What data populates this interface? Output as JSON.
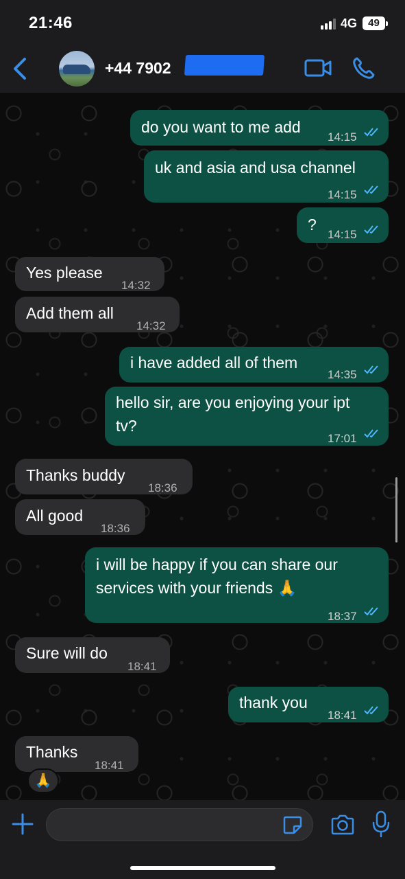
{
  "status": {
    "time": "21:46",
    "network": "4G",
    "battery": "49"
  },
  "header": {
    "contact": "+44 7902 ",
    "icons": [
      "back-chevron-icon",
      "video-call-icon",
      "phone-icon"
    ]
  },
  "colors": {
    "outgoing": "#0c5143",
    "incoming": "#2d2d2f",
    "accent": "#3a8ee6",
    "ticks": "#4fb6ff"
  },
  "messages": [
    {
      "dir": "out",
      "text": "do you want to me add",
      "time": "14:15"
    },
    {
      "dir": "out",
      "text": "uk and asia and usa channel",
      "time": "14:15"
    },
    {
      "dir": "out",
      "text": "?",
      "time": "14:15"
    },
    {
      "dir": "in",
      "text": "Yes please",
      "time": "14:32"
    },
    {
      "dir": "in",
      "text": "Add them all",
      "time": "14:32"
    },
    {
      "dir": "out",
      "text": "i have added all of them",
      "time": "14:35"
    },
    {
      "dir": "out",
      "text": "hello sir, are you enjoying your ipt tv?",
      "time": "17:01"
    },
    {
      "dir": "in",
      "text": "Thanks buddy",
      "time": "18:36"
    },
    {
      "dir": "in",
      "text": "All good",
      "time": "18:36"
    },
    {
      "dir": "out",
      "text": "i will be happy if you can share our services with your friends 🙏",
      "time": "18:37"
    },
    {
      "dir": "in",
      "text": "Sure will do",
      "time": "18:41"
    },
    {
      "dir": "out",
      "text": "thank you",
      "time": "18:41"
    },
    {
      "dir": "in",
      "text": "Thanks",
      "time": "18:41"
    }
  ],
  "reaction": "🙏",
  "composer": {
    "placeholder": "",
    "icons": [
      "plus-icon",
      "sticker-icon",
      "camera-icon",
      "microphone-icon"
    ]
  }
}
